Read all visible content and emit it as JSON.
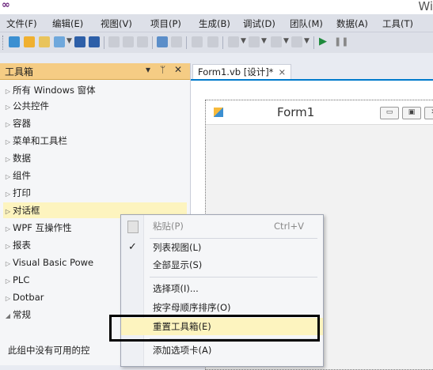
{
  "window": {
    "title": "Wi"
  },
  "menu": [
    "文件(F)",
    "编辑(E)",
    "视图(V)",
    "项目(P)",
    "生成(B)",
    "调试(D)",
    "团队(M)",
    "数据(A)",
    "工具(T)"
  ],
  "toolbox": {
    "title": "工具箱",
    "pin": "▾ ᛘ ✕",
    "items": [
      "所有 Windows 窗体",
      "公共控件",
      "容器",
      "菜单和工具栏",
      "数据",
      "组件",
      "打印",
      "对话框",
      "WPF 互操作性",
      "报表",
      "Visual Basic Powe",
      "PLC",
      "Dotbar",
      "常规"
    ],
    "selected_index": 7,
    "expanded_index": 13,
    "empty_text": "此组中没有可用的控"
  },
  "document": {
    "tab_label": "Form1.vb [设计]*",
    "tab_close": "×",
    "form_title": "Form1"
  },
  "context_menu": {
    "items": [
      {
        "label": "粘贴(P)",
        "shortcut": "Ctrl+V",
        "disabled": true
      },
      {
        "label": "列表视图(L)",
        "checked": true
      },
      {
        "label": "全部显示(S)"
      },
      {
        "label": "选择项(I)..."
      },
      {
        "label": "按字母顺序排序(O)"
      },
      {
        "label": "重置工具箱(E)"
      },
      {
        "label": "添加选项卡(A)"
      }
    ],
    "check_mark": "✓"
  },
  "colors": {
    "accent": "#007acc",
    "highlight": "#fdf4bf",
    "header": "#f5cc84"
  }
}
